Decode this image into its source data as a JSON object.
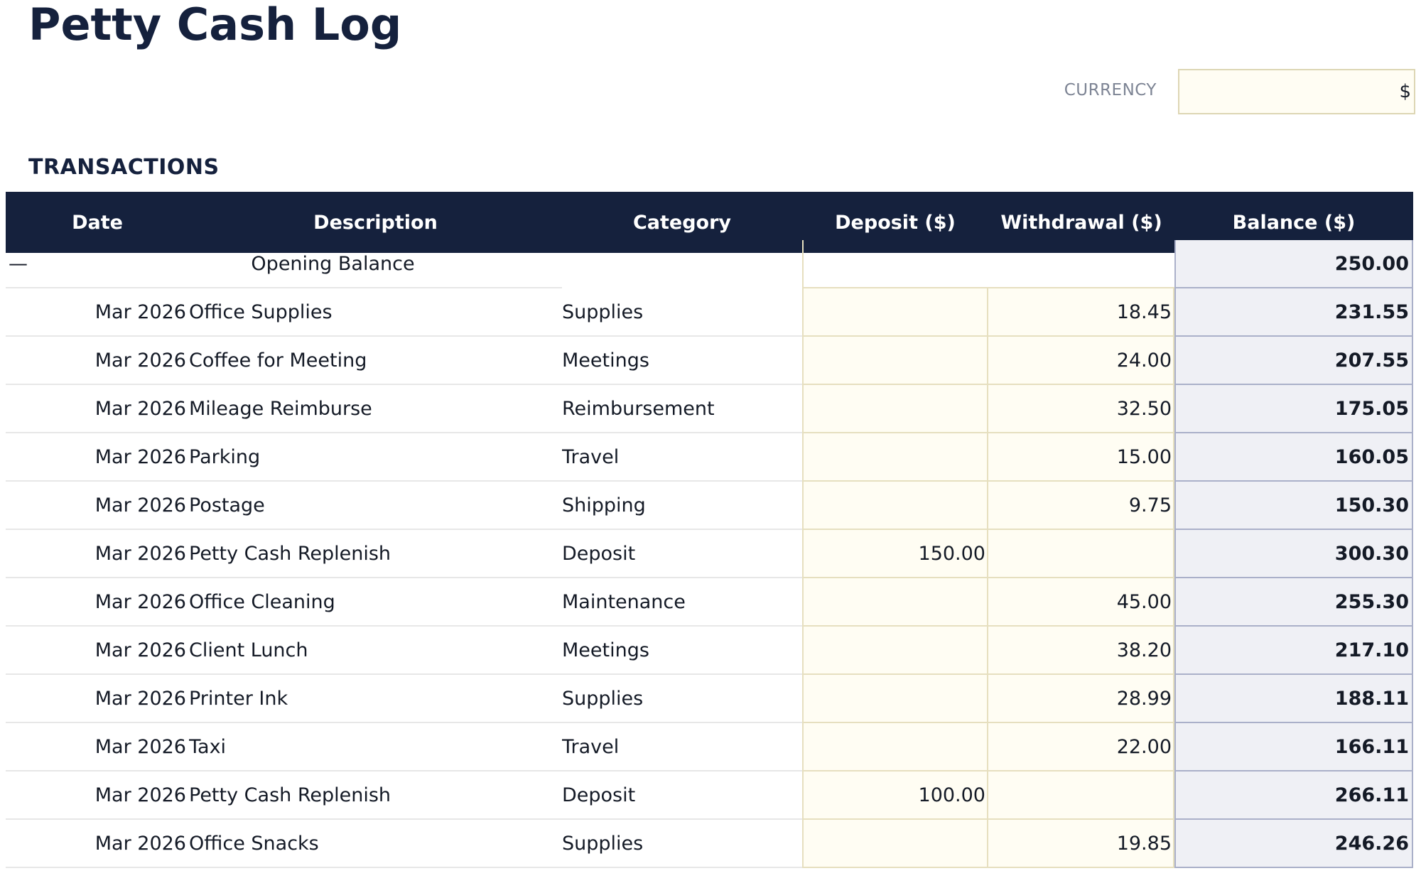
{
  "page": {
    "title": "Petty Cash Log",
    "currency_label": "CURRENCY",
    "currency_value": "$",
    "section_title": "TRANSACTIONS"
  },
  "table": {
    "headers": [
      "Date",
      "Description",
      "Category",
      "Deposit ($)",
      "Withdrawal ($)",
      "Balance ($)"
    ],
    "opening": {
      "date": "—",
      "description": "Opening Balance",
      "balance": "250.00"
    },
    "rows": [
      {
        "date": "Mar 2026",
        "description": "Office Supplies",
        "category": "Supplies",
        "deposit": "",
        "withdrawal": "18.45",
        "balance": "231.55"
      },
      {
        "date": "Mar 2026",
        "description": "Coffee for Meeting",
        "category": "Meetings",
        "deposit": "",
        "withdrawal": "24.00",
        "balance": "207.55"
      },
      {
        "date": "Mar 2026",
        "description": "Mileage Reimburse",
        "category": "Reimbursement",
        "deposit": "",
        "withdrawal": "32.50",
        "balance": "175.05"
      },
      {
        "date": "Mar 2026",
        "description": "Parking",
        "category": "Travel",
        "deposit": "",
        "withdrawal": "15.00",
        "balance": "160.05"
      },
      {
        "date": "Mar 2026",
        "description": "Postage",
        "category": "Shipping",
        "deposit": "",
        "withdrawal": "9.75",
        "balance": "150.30"
      },
      {
        "date": "Mar 2026",
        "description": "Petty Cash Replenish",
        "category": "Deposit",
        "deposit": "150.00",
        "withdrawal": "",
        "balance": "300.30"
      },
      {
        "date": "Mar 2026",
        "description": "Office Cleaning",
        "category": "Maintenance",
        "deposit": "",
        "withdrawal": "45.00",
        "balance": "255.30"
      },
      {
        "date": "Mar 2026",
        "description": "Client Lunch",
        "category": "Meetings",
        "deposit": "",
        "withdrawal": "38.20",
        "balance": "217.10"
      },
      {
        "date": "Mar 2026",
        "description": "Printer Ink",
        "category": "Supplies",
        "deposit": "",
        "withdrawal": "28.99",
        "balance": "188.11"
      },
      {
        "date": "Mar 2026",
        "description": "Taxi",
        "category": "Travel",
        "deposit": "",
        "withdrawal": "22.00",
        "balance": "166.11"
      },
      {
        "date": "Mar 2026",
        "description": "Petty Cash Replenish",
        "category": "Deposit",
        "deposit": "100.00",
        "withdrawal": "",
        "balance": "266.11"
      },
      {
        "date": "Mar 2026",
        "description": "Office Snacks",
        "category": "Supplies",
        "deposit": "",
        "withdrawal": "19.85",
        "balance": "246.26"
      }
    ]
  },
  "colors": {
    "header_bg": "#15213d",
    "input_bg": "#fffdf3",
    "balance_bg": "#eff0f5"
  }
}
